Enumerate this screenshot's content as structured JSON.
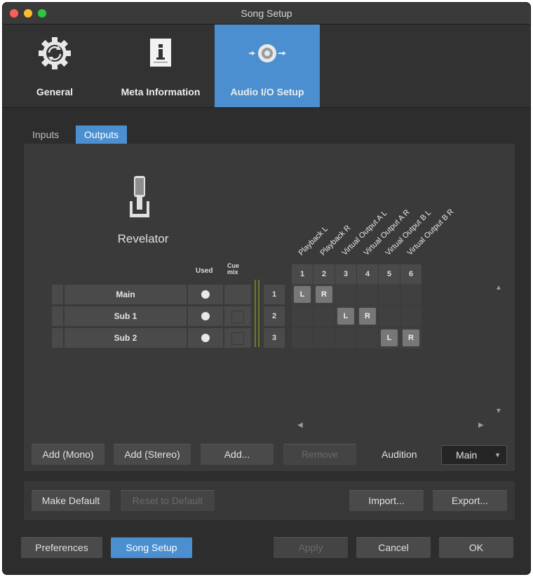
{
  "window": {
    "title": "Song Setup"
  },
  "toolbar": [
    {
      "label": "General",
      "icon": "gear-icon"
    },
    {
      "label": "Meta Information",
      "icon": "document-info-icon"
    },
    {
      "label": "Audio I/O Setup",
      "icon": "audio-io-icon"
    }
  ],
  "tabs": {
    "inputs": "Inputs",
    "outputs": "Outputs"
  },
  "device": {
    "name": "Revelator"
  },
  "columns": {
    "used": "Used",
    "cue_mix": "Cue mix"
  },
  "outputs": [
    {
      "name": "Main",
      "num": "1"
    },
    {
      "name": "Sub 1",
      "num": "2"
    },
    {
      "name": "Sub 2",
      "num": "3"
    }
  ],
  "channels": [
    {
      "label": "Playback L",
      "num": "1"
    },
    {
      "label": "Playback R",
      "num": "2"
    },
    {
      "label": "Virtual Output A L",
      "num": "3"
    },
    {
      "label": "Virtual Output A R",
      "num": "4"
    },
    {
      "label": "Virtual Output B L",
      "num": "5"
    },
    {
      "label": "Virtual Output B R",
      "num": "6"
    }
  ],
  "assignments": {
    "main_l": "L",
    "main_r": "R",
    "sub1_l": "L",
    "sub1_r": "R",
    "sub2_l": "L",
    "sub2_r": "R"
  },
  "buttons": {
    "add_mono": "Add (Mono)",
    "add_stereo": "Add (Stereo)",
    "add": "Add...",
    "remove": "Remove",
    "audition_label": "Audition",
    "audition_value": "Main",
    "make_default": "Make Default",
    "reset_default": "Reset to Default",
    "import": "Import...",
    "export": "Export...",
    "preferences": "Preferences",
    "song_setup": "Song Setup",
    "apply": "Apply",
    "cancel": "Cancel",
    "ok": "OK"
  },
  "colors": {
    "accent": "#4b8fd0",
    "close": "#fc5f57",
    "minimize": "#fdbb2e",
    "zoom": "#29c840"
  }
}
